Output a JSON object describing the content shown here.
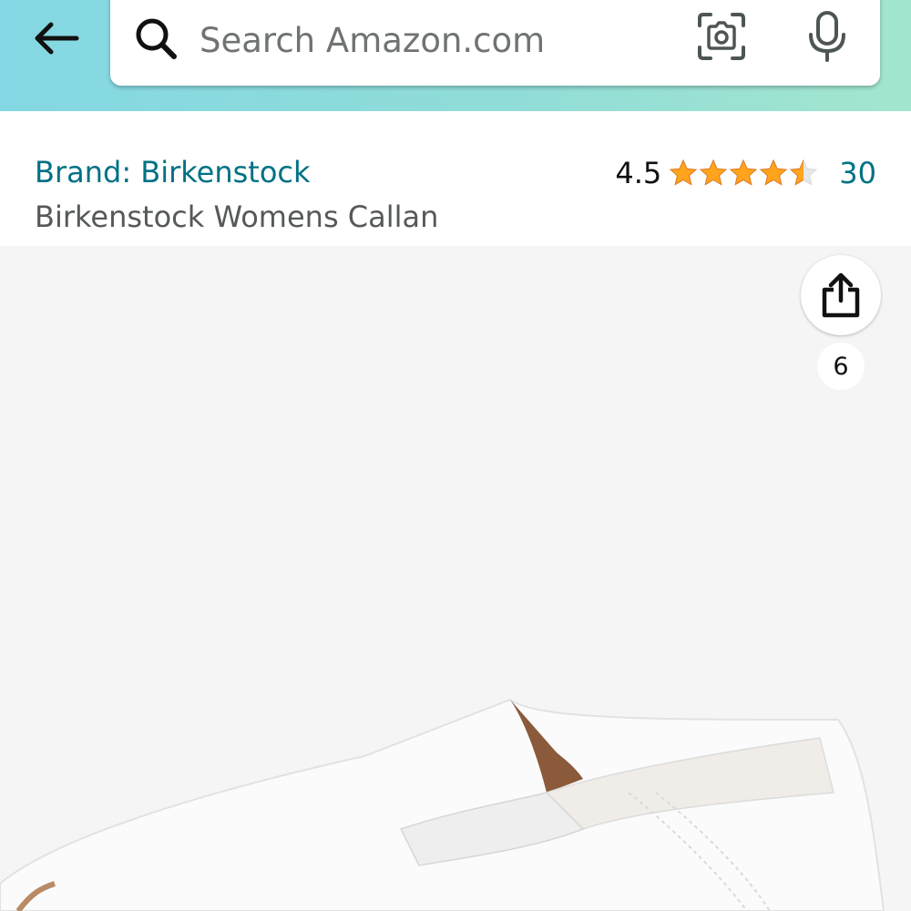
{
  "search": {
    "placeholder": "Search Amazon.com"
  },
  "icons": {
    "back": "back-arrow-icon",
    "search": "search-icon",
    "camera": "camera-icon",
    "mic": "microphone-icon",
    "share": "share-icon",
    "star": "star-icon"
  },
  "product": {
    "brand_label": "Brand: Birkenstock",
    "title": "Birkenstock Womens Callan",
    "rating_value": "4.5",
    "rating_stars": 4.5,
    "rating_max": 5,
    "rating_count": "30"
  },
  "gallery": {
    "image_count": "6"
  },
  "colors": {
    "link": "#007185",
    "star": "#ffa41c",
    "header_gradient_start": "#84d8e3",
    "header_gradient_end": "#a3e6cf"
  }
}
